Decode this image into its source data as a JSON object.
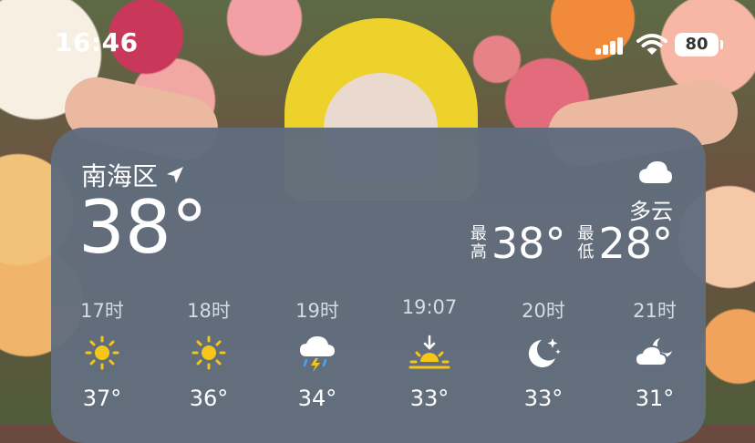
{
  "status_bar": {
    "time": "16:46",
    "battery": "80",
    "icons": [
      "cellular-signal-icon",
      "wifi-icon",
      "battery-icon"
    ]
  },
  "widget": {
    "location": "南海区",
    "location_icon": "location-arrow-icon",
    "current_temp": "38°",
    "condition_icon": "cloud-icon",
    "condition": "多云",
    "high_label": "最高",
    "high": "38°",
    "low_label": "最低",
    "low": "28°",
    "hourly": [
      {
        "time": "17时",
        "icon": "sun-icon",
        "temp": "37°"
      },
      {
        "time": "18时",
        "icon": "sun-icon",
        "temp": "36°"
      },
      {
        "time": "19时",
        "icon": "thunderstorm-icon",
        "temp": "34°"
      },
      {
        "time": "19:07",
        "icon": "sunset-icon",
        "temp": "33°"
      },
      {
        "time": "20时",
        "icon": "moon-stars-icon",
        "temp": "33°"
      },
      {
        "time": "21时",
        "icon": "partly-cloudy-night-icon",
        "temp": "31°"
      }
    ]
  },
  "colors": {
    "sun": "#f5c518",
    "widget_bg": "#637084",
    "rain": "#4aa3f5"
  }
}
